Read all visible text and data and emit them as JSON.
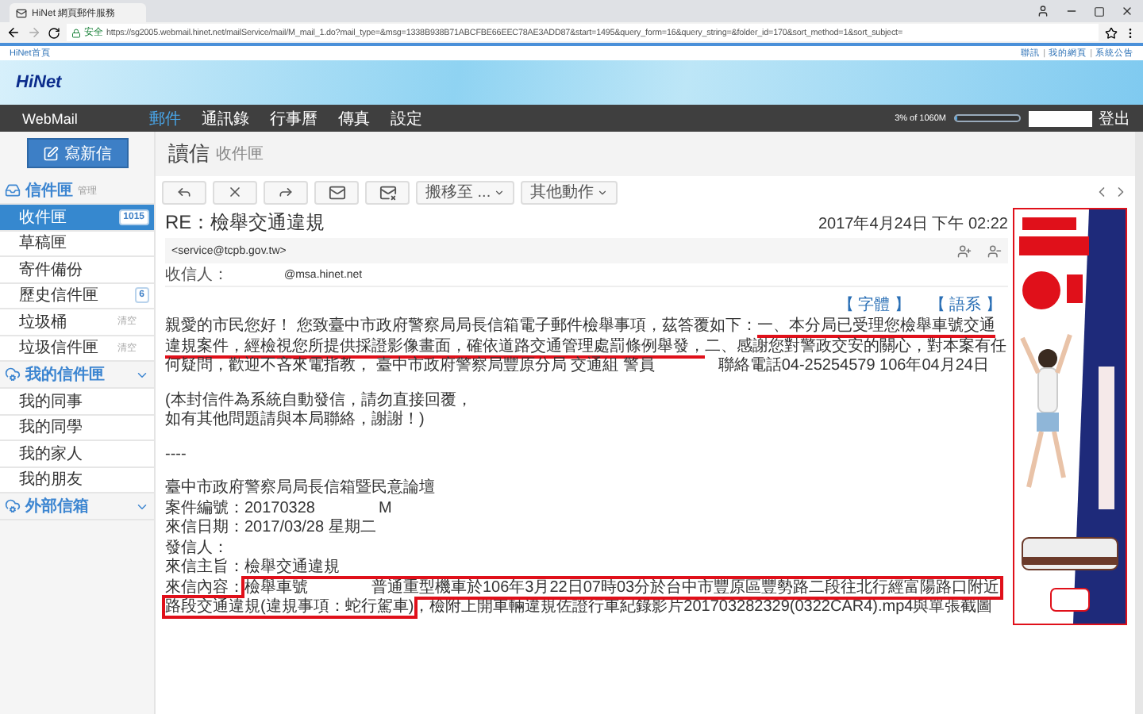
{
  "browser": {
    "tab_title": "HiNet 網頁郵件服務",
    "secure_label": "安全",
    "url": "https://sg2005.webmail.hinet.net/mailService/mail/M_mail_1.do?mail_type=&msg=1338B938B71ABCFBE66EEC78AE3ADD87&start=1495&query_form=16&query_string=&folder_id=170&sort_method=1&sort_subject="
  },
  "top_links": {
    "home": "HiNet首頁",
    "right": [
      "聯訊",
      "我的網頁",
      "系統公告"
    ],
    "separator": "|"
  },
  "logo": "HiNet",
  "nav": {
    "brand": "WebMail",
    "items": [
      {
        "label": "郵件",
        "selected": true
      },
      {
        "label": "通訊錄",
        "selected": false
      },
      {
        "label": "行事曆",
        "selected": false
      },
      {
        "label": "傳真",
        "selected": false
      },
      {
        "label": "設定",
        "selected": false
      }
    ],
    "quota": "3% of 1060M",
    "quota_bar": {
      "level": 0.03
    },
    "logout": "登出"
  },
  "sidebar": {
    "compose": "寫新信",
    "sections": [
      {
        "kind": "folders",
        "title": "信件匣",
        "action": "管理",
        "items": [
          {
            "label": "收件匣",
            "selected": true,
            "badge": "1015"
          },
          {
            "label": "草稿匣",
            "selected": false
          },
          {
            "label": "寄件備份",
            "selected": false
          },
          {
            "label": "歷史信件匣",
            "selected": false,
            "badge": "6"
          },
          {
            "label": "垃圾桶",
            "selected": false,
            "action": "清空"
          },
          {
            "label": "垃圾信件匣",
            "selected": false,
            "action": "清空"
          }
        ]
      },
      {
        "kind": "group",
        "title": "我的信件匣",
        "items": [
          {
            "label": "我的同事",
            "selected": false
          },
          {
            "label": "我的同學",
            "selected": false
          },
          {
            "label": "我的家人",
            "selected": false
          },
          {
            "label": "我的朋友",
            "selected": false
          }
        ]
      },
      {
        "kind": "group",
        "title": "外部信箱"
      }
    ]
  },
  "main": {
    "title": "讀信",
    "subtitle": "收件匣",
    "toolbar": [
      {
        "kind": "reply"
      },
      {
        "kind": "delete"
      },
      {
        "kind": "forward"
      },
      {
        "kind": "mail-in"
      },
      {
        "kind": "mail-out"
      },
      {
        "kind": "dropdown",
        "label": "搬移至 ..."
      },
      {
        "kind": "dropdown",
        "label": "其他動作"
      }
    ],
    "message": {
      "subject": "RE：檢舉交通違規",
      "date": "2017年4月24日 下午 02:22",
      "sender": "<service@tcpb.gov.tw>",
      "recipient_label": "收信人：",
      "recipient": "@msa.hinet.net",
      "links": [
        "【 字體 】",
        "【 語系 】"
      ],
      "blocks": [
        {
          "lines": [
            {
              "segments": [
                {
                  "text": "親愛的市民您好！ 您致臺中市政府警察局局長信箱電子郵件檢舉事項，茲答覆如下："
                },
                {
                  "text": "一、本分局已受理您檢舉車號交通違規案件，經檢視您所提供採證影像畫面，確依道路交通管理處罰條例舉發，",
                  "underlined": true
                },
                {
                  "text": "二、感謝您對警政交安的關心，對本案有任何疑問，歡迎不吝來電指教， 臺中市政府警察局豐原分局 交通組 警員　　　　聯絡電話04-25254579 106年04月24日"
                }
              ]
            }
          ]
        },
        {
          "lines": [
            {
              "segments": [
                {
                  "text": "(本封信件為系統自動發信，請勿直接回覆，"
                }
              ]
            },
            {
              "segments": [
                {
                  "text": "如有其他問題請與本局聯絡，謝謝！)"
                }
              ]
            }
          ]
        },
        {
          "lines": [
            {
              "segments": [
                {
                  "text": "----"
                }
              ]
            }
          ]
        },
        {
          "lines": [
            {
              "segments": [
                {
                  "text": "臺中市政府警察局局長信箱暨民意論壇"
                }
              ]
            },
            {
              "segments": [
                {
                  "text": "案件編號：20170328　　　　M"
                }
              ]
            },
            {
              "segments": [
                {
                  "text": "來信日期：2017/03/28 星期二"
                }
              ]
            },
            {
              "segments": [
                {
                  "text": "發信人："
                }
              ]
            },
            {
              "segments": [
                {
                  "text": "來信主旨：檢舉交通違規"
                }
              ]
            },
            {
              "segments": [
                {
                  "text": "來信內容："
                },
                {
                  "text": "檢舉車號　　　　普通重型機車於106年3月22日07時03分於台中市豐原區豐勢路二段往北行經富陽路口附近路段交通違規(違規事項：蛇行駕車)",
                  "boxed": true
                },
                {
                  "text": "，檢附上開車輛違規佐證行車紀錄影片201703282329(0322CAR4).mp4與單張截圖"
                }
              ]
            }
          ]
        }
      ]
    }
  }
}
